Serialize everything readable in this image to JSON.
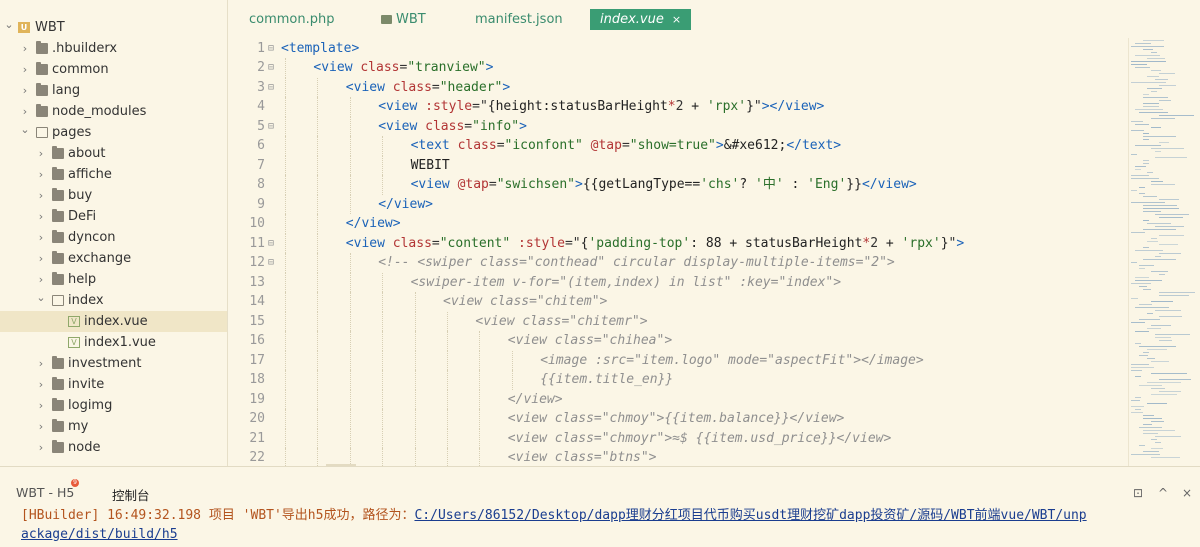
{
  "sidebar": {
    "root": {
      "label": "WBT"
    },
    "items": [
      {
        "label": ".hbuilderx",
        "type": "folder",
        "expanded": false,
        "depth": 1
      },
      {
        "label": "common",
        "type": "folder",
        "expanded": false,
        "depth": 1
      },
      {
        "label": "lang",
        "type": "folder",
        "expanded": false,
        "depth": 1
      },
      {
        "label": "node_modules",
        "type": "folder",
        "expanded": false,
        "depth": 1
      },
      {
        "label": "pages",
        "type": "folder",
        "expanded": true,
        "depth": 1
      },
      {
        "label": "about",
        "type": "folder",
        "expanded": false,
        "depth": 2
      },
      {
        "label": "affiche",
        "type": "folder",
        "expanded": false,
        "depth": 2
      },
      {
        "label": "buy",
        "type": "folder",
        "expanded": false,
        "depth": 2
      },
      {
        "label": "DeFi",
        "type": "folder",
        "expanded": false,
        "depth": 2
      },
      {
        "label": "dyncon",
        "type": "folder",
        "expanded": false,
        "depth": 2
      },
      {
        "label": "exchange",
        "type": "folder",
        "expanded": false,
        "depth": 2
      },
      {
        "label": "help",
        "type": "folder",
        "expanded": false,
        "depth": 2
      },
      {
        "label": "index",
        "type": "folder",
        "expanded": true,
        "depth": 2
      },
      {
        "label": "index.vue",
        "type": "vue",
        "depth": 3,
        "selected": true
      },
      {
        "label": "index1.vue",
        "type": "vue",
        "depth": 3
      },
      {
        "label": "investment",
        "type": "folder",
        "expanded": false,
        "depth": 2
      },
      {
        "label": "invite",
        "type": "folder",
        "expanded": false,
        "depth": 2
      },
      {
        "label": "logimg",
        "type": "folder",
        "expanded": false,
        "depth": 2
      },
      {
        "label": "my",
        "type": "folder",
        "expanded": false,
        "depth": 2
      },
      {
        "label": "node",
        "type": "folder",
        "expanded": false,
        "depth": 2
      }
    ]
  },
  "tabs": [
    {
      "label": "common.php",
      "active": false
    },
    {
      "label": "WBT",
      "active": false,
      "folder": true
    },
    {
      "label": "manifest.json",
      "active": false
    },
    {
      "label": "index.vue",
      "active": true
    }
  ],
  "tab_close": "×",
  "editor": {
    "lines": [
      {
        "n": "1",
        "fold": "⊟",
        "indent": 0,
        "tokens": [
          [
            "tag",
            "<template>"
          ]
        ]
      },
      {
        "n": "2",
        "fold": "⊟",
        "indent": 1,
        "tokens": [
          [
            "tag",
            "<view "
          ],
          [
            "attr",
            "class"
          ],
          [
            "punc",
            "="
          ],
          [
            "str",
            "\"tranview\""
          ],
          [
            "tag",
            ">"
          ]
        ]
      },
      {
        "n": "3",
        "fold": "⊟",
        "indent": 2,
        "tokens": [
          [
            "tag",
            "<view "
          ],
          [
            "attr",
            "class"
          ],
          [
            "punc",
            "="
          ],
          [
            "str",
            "\"header\""
          ],
          [
            "tag",
            ">"
          ]
        ]
      },
      {
        "n": "4",
        "fold": "",
        "indent": 3,
        "tokens": [
          [
            "tag",
            "<view "
          ],
          [
            "attr",
            ":style"
          ],
          [
            "punc",
            "=\""
          ],
          [
            "txt",
            "{height:statusBarHeight"
          ],
          [
            "op",
            "*"
          ],
          [
            "num",
            "2"
          ],
          [
            "txt",
            " + "
          ],
          [
            "str",
            "'rpx'"
          ],
          [
            "txt",
            "}"
          ],
          [
            "punc",
            "\""
          ],
          [
            "tag",
            "></view>"
          ]
        ]
      },
      {
        "n": "5",
        "fold": "⊟",
        "indent": 3,
        "tokens": [
          [
            "tag",
            "<view "
          ],
          [
            "attr",
            "class"
          ],
          [
            "punc",
            "="
          ],
          [
            "str",
            "\"info\""
          ],
          [
            "tag",
            ">"
          ]
        ]
      },
      {
        "n": "6",
        "fold": "",
        "indent": 4,
        "tokens": [
          [
            "tag",
            "<text "
          ],
          [
            "attr",
            "class"
          ],
          [
            "punc",
            "="
          ],
          [
            "str",
            "\"iconfont\""
          ],
          [
            "txt",
            " "
          ],
          [
            "attr",
            "@tap"
          ],
          [
            "punc",
            "="
          ],
          [
            "str",
            "\"show=true\""
          ],
          [
            "tag",
            ">"
          ],
          [
            "txt",
            "&#xe612;"
          ],
          [
            "tag",
            "</text>"
          ]
        ]
      },
      {
        "n": "7",
        "fold": "",
        "indent": 4,
        "tokens": [
          [
            "txt",
            "WEBIT"
          ]
        ]
      },
      {
        "n": "8",
        "fold": "",
        "indent": 4,
        "tokens": [
          [
            "tag",
            "<view "
          ],
          [
            "attr",
            "@tap"
          ],
          [
            "punc",
            "="
          ],
          [
            "str",
            "\"swichsen\""
          ],
          [
            "tag",
            ">"
          ],
          [
            "txt",
            "{{getLangType=="
          ],
          [
            "str",
            "'chs'"
          ],
          [
            "txt",
            "? "
          ],
          [
            "str",
            "'中'"
          ],
          [
            "txt",
            " : "
          ],
          [
            "str",
            "'Eng'"
          ],
          [
            "txt",
            "}}"
          ],
          [
            "tag",
            "</view>"
          ]
        ]
      },
      {
        "n": "9",
        "fold": "",
        "indent": 3,
        "tokens": [
          [
            "tag",
            "</view>"
          ]
        ]
      },
      {
        "n": "10",
        "fold": "",
        "indent": 2,
        "tokens": [
          [
            "tag",
            "</view>"
          ]
        ]
      },
      {
        "n": "11",
        "fold": "⊟",
        "indent": 2,
        "tokens": [
          [
            "tag",
            "<view "
          ],
          [
            "attr",
            "class"
          ],
          [
            "punc",
            "="
          ],
          [
            "str",
            "\"content\""
          ],
          [
            "txt",
            " "
          ],
          [
            "attr",
            ":style"
          ],
          [
            "punc",
            "=\""
          ],
          [
            "txt",
            "{"
          ],
          [
            "str",
            "'padding-top'"
          ],
          [
            "txt",
            ": 88 + statusBarHeight"
          ],
          [
            "op",
            "*"
          ],
          [
            "num",
            "2"
          ],
          [
            "txt",
            " + "
          ],
          [
            "str",
            "'rpx'"
          ],
          [
            "txt",
            "}"
          ],
          [
            "punc",
            "\""
          ],
          [
            "tag",
            ">"
          ]
        ]
      },
      {
        "n": "12",
        "fold": "⊟",
        "indent": 3,
        "tokens": [
          [
            "cmt",
            "<!-- <swiper class=\"conthead\" circular display-multiple-items=\"2\">"
          ]
        ]
      },
      {
        "n": "13",
        "fold": "",
        "indent": 4,
        "tokens": [
          [
            "cmt",
            "<swiper-item v-for=\"(item,index) in list\" :key=\"index\">"
          ]
        ]
      },
      {
        "n": "14",
        "fold": "",
        "indent": 5,
        "tokens": [
          [
            "cmt",
            "<view class=\"chitem\">"
          ]
        ]
      },
      {
        "n": "15",
        "fold": "",
        "indent": 6,
        "tokens": [
          [
            "cmt",
            "<view class=\"chitemr\">"
          ]
        ]
      },
      {
        "n": "16",
        "fold": "",
        "indent": 7,
        "tokens": [
          [
            "cmt",
            "<view class=\"chihea\">"
          ]
        ]
      },
      {
        "n": "17",
        "fold": "",
        "indent": 8,
        "tokens": [
          [
            "cmt",
            "<image :src=\"item.logo\" mode=\"aspectFit\"></image>"
          ]
        ]
      },
      {
        "n": "18",
        "fold": "",
        "indent": 8,
        "tokens": [
          [
            "cmt",
            "{{item.title_en}}"
          ]
        ]
      },
      {
        "n": "19",
        "fold": "",
        "indent": 7,
        "tokens": [
          [
            "cmt",
            "</view>"
          ]
        ]
      },
      {
        "n": "20",
        "fold": "",
        "indent": 7,
        "tokens": [
          [
            "cmt",
            "<view class=\"chmoy\">{{item.balance}}</view>"
          ]
        ]
      },
      {
        "n": "21",
        "fold": "",
        "indent": 7,
        "tokens": [
          [
            "cmt",
            "<view class=\"chmoyr\">≈$ {{item.usd_price}}</view>"
          ]
        ]
      },
      {
        "n": "22",
        "fold": "",
        "indent": 7,
        "tokens": [
          [
            "cmt",
            "<view class=\"btns\">"
          ]
        ]
      }
    ]
  },
  "panel": {
    "tab_app": "WBT - H5",
    "badge": "9",
    "tab_console": "控制台",
    "controls": [
      "⊡",
      "^",
      "×"
    ]
  },
  "console": {
    "prefix": "[HBuilder] 16:49:32.198 项目 'WBT'导出h5成功，路径为：",
    "path_1": "C:/Users/86152/Desktop/dapp理财分红项目代币购买usdt理财挖矿dapp投资矿/源码/WBT前端vue/WBT/unp",
    "path_2": "ackage/dist/build/h5"
  }
}
